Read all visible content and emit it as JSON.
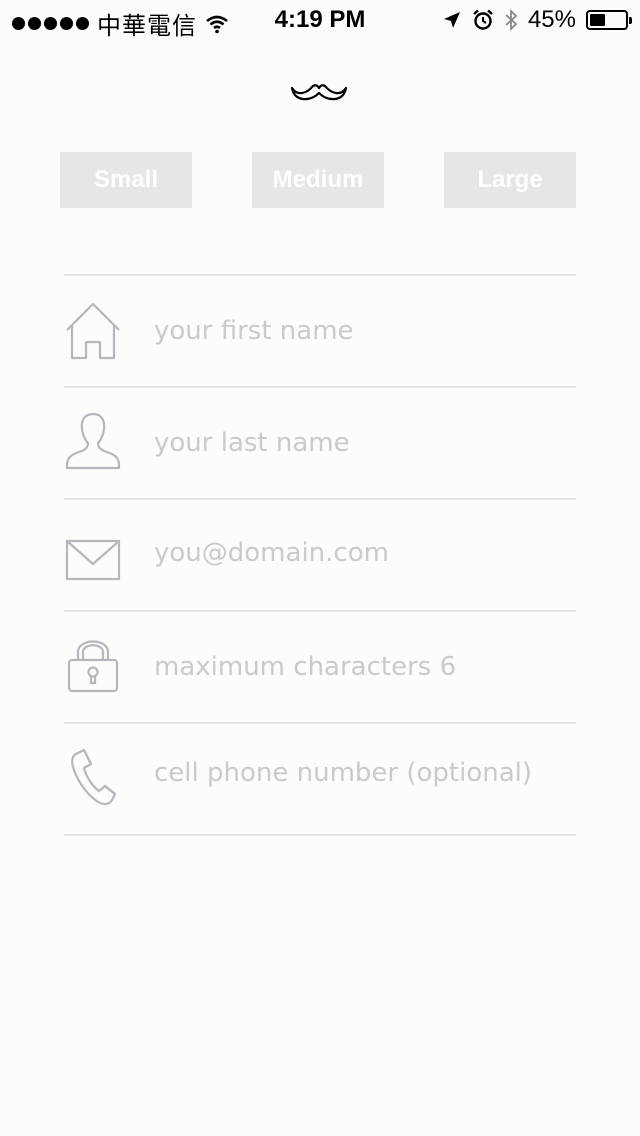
{
  "status_bar": {
    "carrier": "中華電信",
    "time": "4:19 PM",
    "battery": "45%",
    "battery_level": 0.45
  },
  "logo": {
    "icon": "mustache-icon"
  },
  "size_options": [
    {
      "label": "Small"
    },
    {
      "label": "Medium"
    },
    {
      "label": "Large"
    }
  ],
  "form": {
    "first_name": {
      "placeholder": "your first name",
      "icon": "house-icon"
    },
    "last_name": {
      "placeholder": "your last name",
      "icon": "person-icon"
    },
    "email": {
      "placeholder": "you@domain.com",
      "icon": "envelope-icon"
    },
    "password": {
      "placeholder": "maximum characters 6",
      "icon": "lock-icon"
    },
    "phone": {
      "placeholder": "cell phone number (optional)",
      "icon": "phone-icon"
    }
  },
  "colors": {
    "background": "#fcfcfb",
    "button_bg": "#e8e6e3",
    "button_text": "#ffffff",
    "placeholder": "#cacacc",
    "icon_stroke": "#b6b7bc",
    "divider": "#e5e5e5"
  }
}
